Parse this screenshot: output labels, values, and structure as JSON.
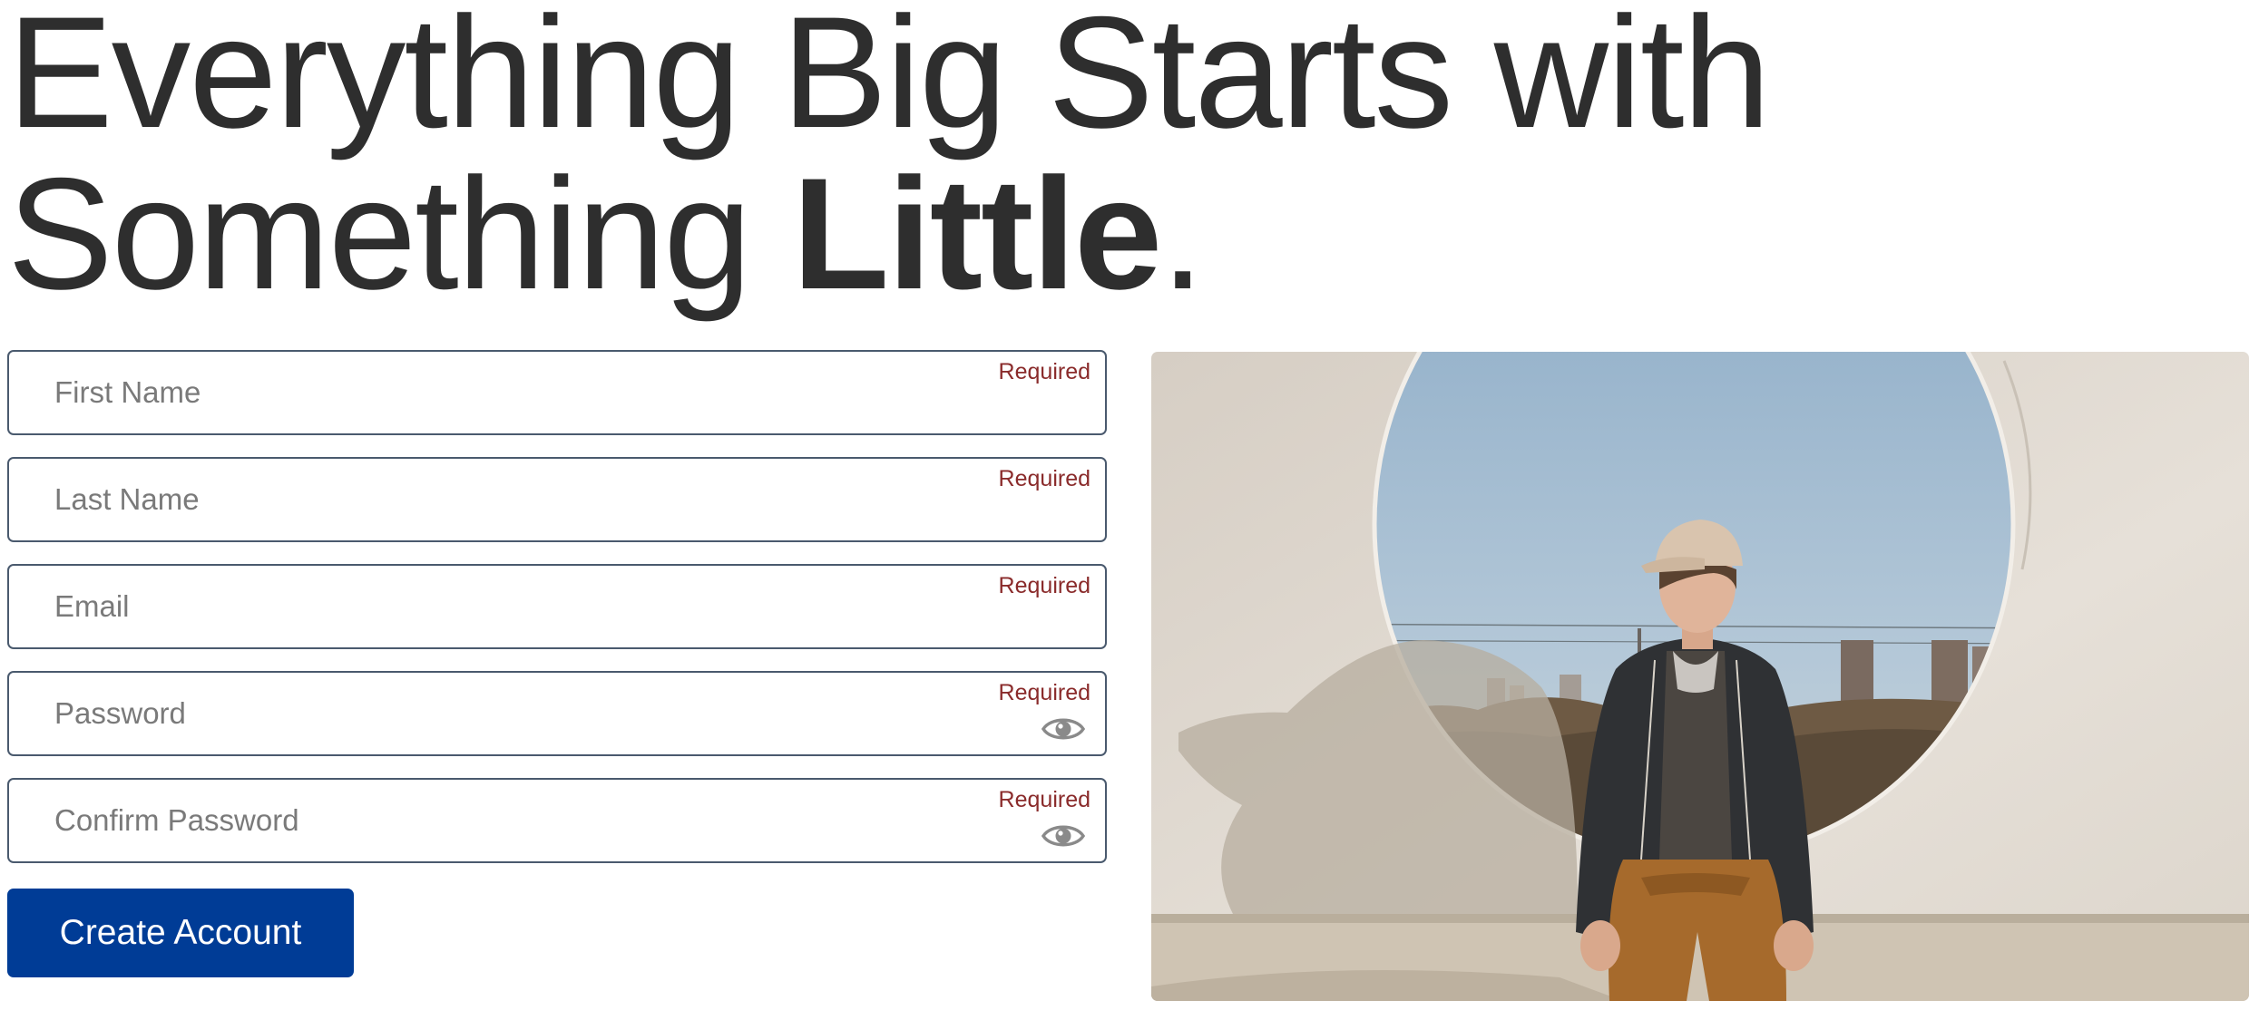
{
  "headline": {
    "line1": "Everything Big Starts with",
    "line2_plain": "Something ",
    "line2_bold": "Little",
    "line2_end": "."
  },
  "form": {
    "first_name": {
      "placeholder": "First Name",
      "required": "Required"
    },
    "last_name": {
      "placeholder": "Last Name",
      "required": "Required"
    },
    "email": {
      "placeholder": "Email",
      "required": "Required"
    },
    "password": {
      "placeholder": "Password",
      "required": "Required",
      "icon": "eye-icon"
    },
    "confirm_password": {
      "placeholder": "Confirm Password",
      "required": "Required",
      "icon": "eye-icon"
    },
    "submit_label": "Create Account"
  },
  "colors": {
    "text": "#2e2e2e",
    "field_border": "#4a5a6e",
    "required": "#8a2b2b",
    "button": "#003c96",
    "button_text": "#ffffff"
  },
  "photo": {
    "subject": "young-man-in-cap-sitting-before-circular-wall-opening"
  }
}
